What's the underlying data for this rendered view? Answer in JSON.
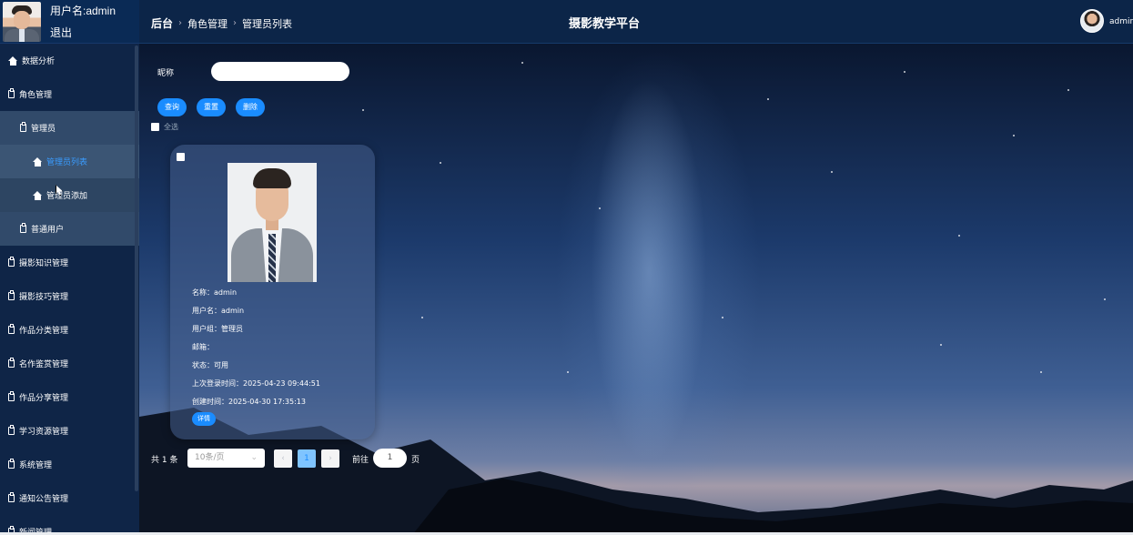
{
  "user": {
    "username_label": "用户名:admin",
    "logout_label": "退出"
  },
  "header": {
    "breadcrumb": [
      "后台",
      "角色管理",
      "管理员列表"
    ],
    "site_title": "摄影教学平台",
    "user_name": "admin"
  },
  "sidebar": {
    "items": [
      {
        "label": "数据分析"
      },
      {
        "label": "角色管理"
      },
      {
        "label": "管理员"
      },
      {
        "label": "管理员列表"
      },
      {
        "label": "管理员添加"
      },
      {
        "label": "普通用户"
      },
      {
        "label": "摄影知识管理"
      },
      {
        "label": "摄影技巧管理"
      },
      {
        "label": "作品分类管理"
      },
      {
        "label": "名作鉴赏管理"
      },
      {
        "label": "作品分享管理"
      },
      {
        "label": "学习资源管理"
      },
      {
        "label": "系统管理"
      },
      {
        "label": "通知公告管理"
      },
      {
        "label": "新闻管理"
      }
    ]
  },
  "search": {
    "label": "昵称",
    "value": "",
    "placeholder": ""
  },
  "actions": {
    "query": "查询",
    "reset": "重置",
    "delete": "删除"
  },
  "select_all_label": "全选",
  "card": {
    "fields": [
      "名称：admin",
      "用户名：admin",
      "用户组：管理员",
      "邮箱：",
      "状态：可用",
      "上次登录时间：2025-04-23 09:44:51",
      "创建时间：2025-04-30 17:35:13"
    ],
    "detail_label": "详情"
  },
  "pagination": {
    "total": "共 1 条",
    "page_size": "10条/页",
    "prev": "‹",
    "current_page": "1",
    "next": "›",
    "goto_label": "前往",
    "goto_value": "1",
    "goto_suffix": "页"
  },
  "colors": {
    "accent": "#1a8cff",
    "sidebar_bg": "#0f2547",
    "active_text": "#3a9cff"
  }
}
